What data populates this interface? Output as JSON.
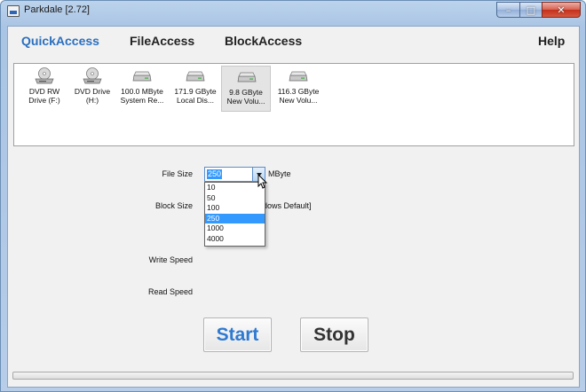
{
  "window": {
    "title": "Parkdale [2.72]"
  },
  "menu": {
    "quick": "QuickAccess",
    "file": "FileAccess",
    "block": "BlockAccess",
    "help": "Help"
  },
  "drives": [
    {
      "line1": "DVD RW",
      "line2": "Drive (F:)",
      "icon": "optical-drive-icon"
    },
    {
      "line1": "DVD Drive",
      "line2": "(H:)",
      "icon": "optical-drive-icon"
    },
    {
      "line1": "100.0 MByte",
      "line2": "System Re...",
      "icon": "hard-drive-icon"
    },
    {
      "line1": "171.9 GByte",
      "line2": "Local Dis...",
      "icon": "hard-drive-icon"
    },
    {
      "line1": "9.8 GByte",
      "line2": "New Volu...",
      "icon": "hard-drive-icon"
    },
    {
      "line1": "116.3 GByte",
      "line2": "New Volu...",
      "icon": "hard-drive-icon"
    }
  ],
  "form": {
    "file_size_label": "File Size",
    "file_size_value": "250",
    "file_size_unit": "MByte",
    "block_size_label": "Block Size",
    "block_size_partial": "dows Default]",
    "write_speed_label": "Write Speed",
    "read_speed_label": "Read Speed"
  },
  "dropdown": {
    "options": [
      "10",
      "50",
      "100",
      "250",
      "1000",
      "4000"
    ],
    "selected": "250"
  },
  "buttons": {
    "start": "Start",
    "stop": "Stop"
  },
  "progress": {
    "percent": 0
  },
  "colors": {
    "accent": "#2b6fbf",
    "selection": "#3399ff"
  }
}
